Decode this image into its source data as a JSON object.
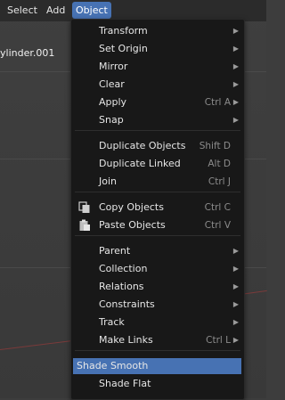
{
  "menubar": {
    "items": [
      {
        "label": "Select"
      },
      {
        "label": "Add"
      },
      {
        "label": "Object"
      }
    ]
  },
  "viewport": {
    "object_name": "ylinder.001"
  },
  "object_menu": {
    "items": [
      {
        "label": "Transform",
        "shortcut": "",
        "submenu": true
      },
      {
        "label": "Set Origin",
        "shortcut": "",
        "submenu": true
      },
      {
        "label": "Mirror",
        "shortcut": "",
        "submenu": true
      },
      {
        "label": "Clear",
        "shortcut": "",
        "submenu": true
      },
      {
        "label": "Apply",
        "shortcut": "Ctrl A",
        "submenu": true
      },
      {
        "label": "Snap",
        "shortcut": "",
        "submenu": true
      },
      {
        "label": "Duplicate Objects",
        "shortcut": "Shift D",
        "submenu": false
      },
      {
        "label": "Duplicate Linked",
        "shortcut": "Alt D",
        "submenu": false
      },
      {
        "label": "Join",
        "shortcut": "Ctrl J",
        "submenu": false
      },
      {
        "label": "Copy Objects",
        "shortcut": "Ctrl C",
        "submenu": false,
        "icon": "copy-icon"
      },
      {
        "label": "Paste Objects",
        "shortcut": "Ctrl V",
        "submenu": false,
        "icon": "paste-icon"
      },
      {
        "label": "Parent",
        "shortcut": "",
        "submenu": true
      },
      {
        "label": "Collection",
        "shortcut": "",
        "submenu": true
      },
      {
        "label": "Relations",
        "shortcut": "",
        "submenu": true
      },
      {
        "label": "Constraints",
        "shortcut": "",
        "submenu": true
      },
      {
        "label": "Track",
        "shortcut": "",
        "submenu": true
      },
      {
        "label": "Make Links",
        "shortcut": "Ctrl L",
        "submenu": true
      },
      {
        "label": "Shade Smooth",
        "shortcut": "",
        "submenu": false,
        "highlighted": true
      },
      {
        "label": "Shade Flat",
        "shortcut": "",
        "submenu": false
      }
    ]
  },
  "colors": {
    "accent": "#4772b3",
    "menu_bg": "#181818",
    "viewport_bg": "#3d3d3d"
  }
}
